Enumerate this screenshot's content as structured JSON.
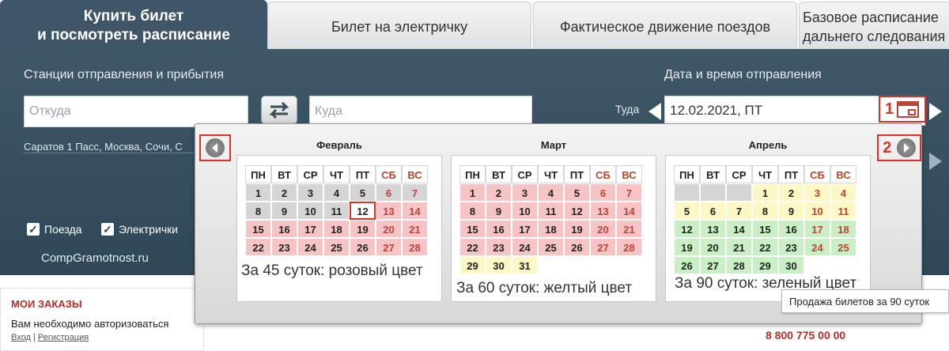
{
  "tabs": [
    {
      "line1": "Купить билет",
      "line2": "и посмотреть расписание"
    },
    {
      "line1": "Билет на электричку",
      "line2": ""
    },
    {
      "line1": "Фактическое движение поездов",
      "line2": ""
    },
    {
      "line1": "Базовое расписание",
      "line2": "дальнего следования"
    }
  ],
  "search": {
    "stations_label": "Станции отправления и прибытия",
    "from_placeholder": "Откуда",
    "to_placeholder": "Куда",
    "quick_stations": "Саратов 1 Пасс, Москва, Сочи, С",
    "date_label": "Дата и время отправления",
    "direction_label": "Туда",
    "date_value": "12.02.2021, ПТ",
    "checkbox_trains": "Поезда",
    "checkbox_electric": "Электрички"
  },
  "markers": {
    "one": "1",
    "two": "2"
  },
  "watermark": "CompGramotnost.ru",
  "orders": {
    "title": "МОИ ЗАКАЗЫ",
    "text": "Вам необходимо авторизоваться",
    "login": "Вход",
    "separator": "|",
    "register": "Регистрация"
  },
  "phone": "8 800 775 00 00",
  "calendar": {
    "weekdays": [
      "ПН",
      "ВТ",
      "СР",
      "ЧТ",
      "ПТ",
      "СБ",
      "ВС"
    ],
    "months": [
      {
        "name": "Февраль",
        "caption": "За 45 суток: розовый цвет",
        "weeks": [
          [
            "1",
            "2",
            "3",
            "4",
            "5",
            "6",
            "7"
          ],
          [
            "8",
            "9",
            "10",
            "11",
            "12",
            "13",
            "14"
          ],
          [
            "15",
            "16",
            "17",
            "18",
            "19",
            "20",
            "21"
          ],
          [
            "22",
            "23",
            "24",
            "25",
            "26",
            "27",
            "28"
          ]
        ]
      },
      {
        "name": "Март",
        "caption": "За 60 суток: желтый цвет",
        "weeks": [
          [
            "1",
            "2",
            "3",
            "4",
            "5",
            "6",
            "7"
          ],
          [
            "8",
            "9",
            "10",
            "11",
            "12",
            "13",
            "14"
          ],
          [
            "15",
            "16",
            "17",
            "18",
            "19",
            "20",
            "21"
          ],
          [
            "22",
            "23",
            "24",
            "25",
            "26",
            "27",
            "28"
          ],
          [
            "29",
            "30",
            "31",
            "",
            "",
            "",
            ""
          ]
        ]
      },
      {
        "name": "Апрель",
        "caption": "За 90 суток: зеленый цвет",
        "weeks": [
          [
            "",
            "",
            "",
            "1",
            "2",
            "3",
            "4"
          ],
          [
            "5",
            "6",
            "7",
            "8",
            "9",
            "10",
            "11"
          ],
          [
            "12",
            "13",
            "14",
            "15",
            "16",
            "17",
            "18"
          ],
          [
            "19",
            "20",
            "21",
            "22",
            "23",
            "24",
            "25"
          ],
          [
            "26",
            "27",
            "28",
            "29",
            "30",
            "",
            ""
          ]
        ]
      }
    ],
    "tooltip": "Продажа билетов за 90 суток"
  },
  "colors": {
    "panel": "#3f5868",
    "pink": "#f6c4c4",
    "yellow": "#fbf8c6",
    "green": "#c9efc4",
    "gray": "#d5d5d5",
    "marker": "#d9322b"
  }
}
